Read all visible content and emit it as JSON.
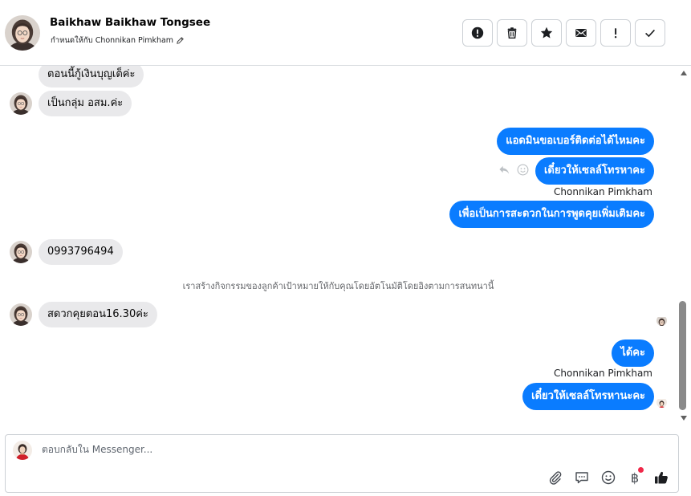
{
  "header": {
    "contact_name": "Baikhaw Baikhaw Tongsee",
    "assigned_label": "กำหนดให้กับ",
    "assignee_name": "Chonnikan Pimkham",
    "actions": [
      {
        "name": "mark-spam-button",
        "icon": "exclamation-circle-icon"
      },
      {
        "name": "delete-button",
        "icon": "trash-icon"
      },
      {
        "name": "star-button",
        "icon": "star-icon"
      },
      {
        "name": "mark-unread-button",
        "icon": "envelope-icon"
      },
      {
        "name": "follow-up-button",
        "icon": "exclamation-icon"
      },
      {
        "name": "mark-done-button",
        "icon": "check-icon"
      }
    ]
  },
  "messages": {
    "in_1": "ตอนนี้กู้เงินบุญเต็ค่ะ",
    "in_2": "เป็นกลุ่ม อสม.ค่ะ",
    "out_1": "แอดมินขอเบอร์ติดต่อได้ไหมคะ",
    "out_2": "เดี๋ยวให้เซลล์โทรหาคะ",
    "sender_1": "Chonnikan Pimkham",
    "out_3": "เพื่อเป็นการสะดวกในการพูดคุยเพิ่มเติมคะ",
    "in_3": "0993796494",
    "system_note": "เราสร้างกิจกรรมของลูกค้าเป้าหมายให้กับคุณโดยอัตโนมัติโดยอิงตามการสนทนานี้",
    "in_4": "สดวกคุยตอน16.30ค่ะ",
    "out_4": "ได้คะ",
    "sender_2": "Chonnikan Pimkham",
    "out_5": "เดี๋ยวให้เซลล์โทรหานะคะ"
  },
  "composer": {
    "placeholder": "ตอบกลับใน Messenger...",
    "tools": [
      "paperclip-icon",
      "saved-reply-icon",
      "emoji-icon",
      "baht-icon",
      "thumbs-up-icon"
    ],
    "baht_symbol": "฿"
  },
  "colors": {
    "outgoing_bubble": "#0a7cff",
    "incoming_bubble": "#e9e9eb",
    "notification_dot": "#f02849"
  }
}
